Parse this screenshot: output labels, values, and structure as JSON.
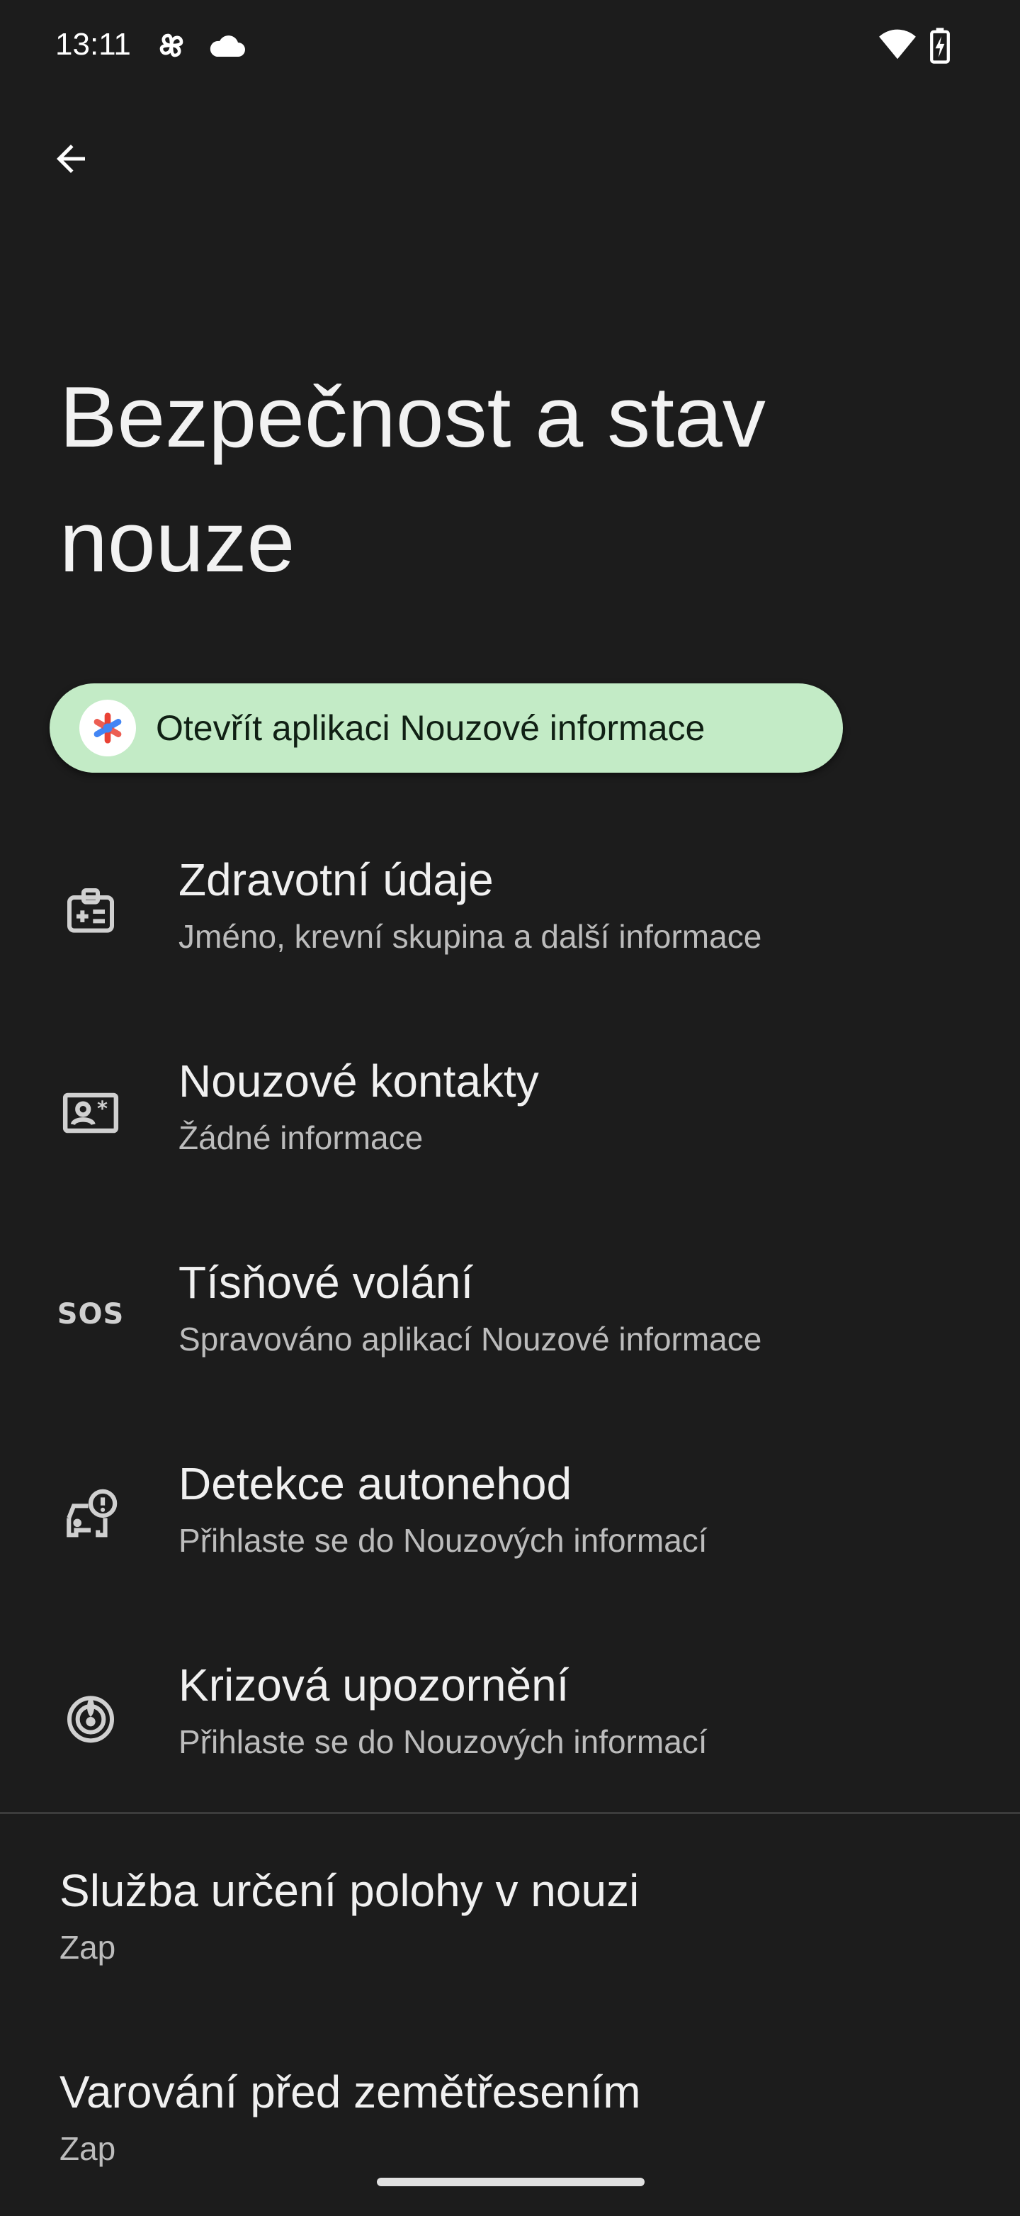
{
  "status_bar": {
    "time": "13:11",
    "icons": [
      "pinwheel-icon",
      "cloud-icon",
      "wifi-icon",
      "battery-charging-icon"
    ]
  },
  "header": {
    "back_icon": "arrow-back-icon",
    "title": "Bezpečnost a stav nouze"
  },
  "chip": {
    "label": "Otevřít aplikaci Nouzové informace",
    "icon": "emergency-info-app-icon",
    "background": "#c3ebc6"
  },
  "items": [
    {
      "icon": "medical-id-icon",
      "title": "Zdravotní údaje",
      "subtitle": "Jméno, krevní skupina a další informace"
    },
    {
      "icon": "contact-card-icon",
      "title": "Nouzové kontakty",
      "subtitle": "Žádné informace"
    },
    {
      "icon": "sos-icon",
      "icon_text": "SOS",
      "title": "Tísňové volání",
      "subtitle": "Spravováno aplikací Nouzové informace"
    },
    {
      "icon": "car-crash-icon",
      "title": "Detekce autonehod",
      "subtitle": "Přihlaste se do Nouzových informací"
    },
    {
      "icon": "crisis-alert-icon",
      "title": "Krizová upozornění",
      "subtitle": "Přihlaste se do Nouzových informací"
    }
  ],
  "settings": [
    {
      "title": "Služba určení polohy v nouzi",
      "value": "Zap"
    },
    {
      "title": "Varování před zemětřesením",
      "value": "Zap"
    }
  ]
}
